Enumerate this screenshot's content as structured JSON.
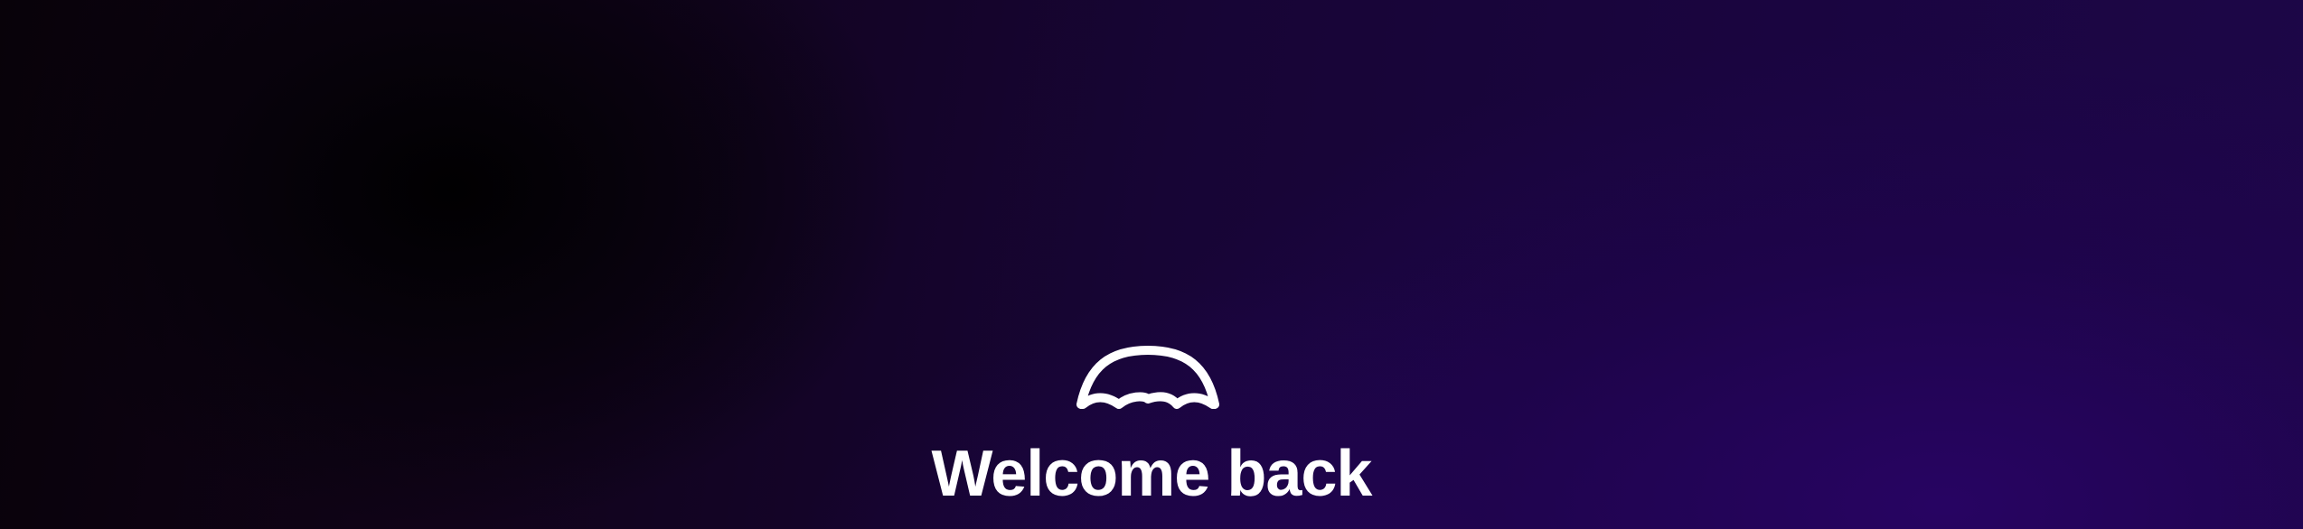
{
  "page": {
    "logo_icon": "dome-wave-logo-icon",
    "title": "Welcome back"
  },
  "colors": {
    "text": "#ffffff",
    "background_dark": "#050108",
    "background_purple": "#1e0650"
  }
}
